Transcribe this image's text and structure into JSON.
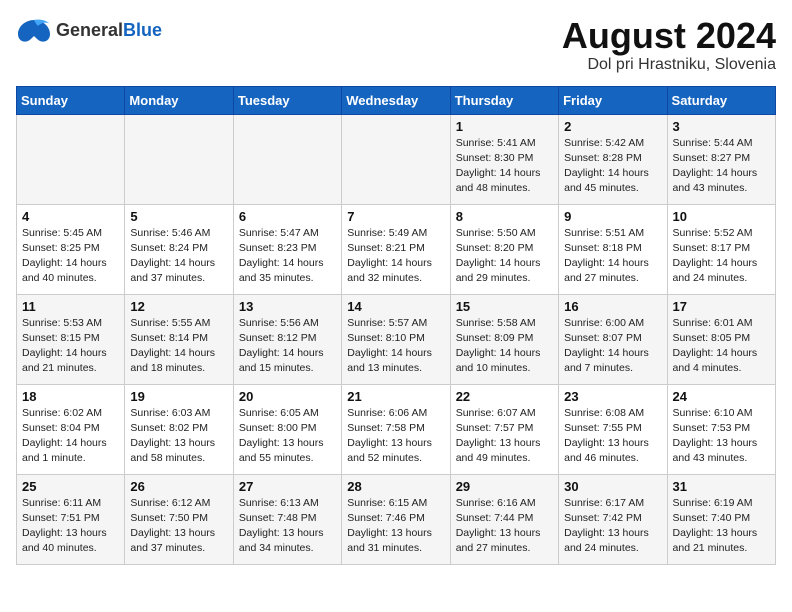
{
  "logo": {
    "general": "General",
    "blue": "Blue"
  },
  "title": "August 2024",
  "subtitle": "Dol pri Hrastniku, Slovenia",
  "weekdays": [
    "Sunday",
    "Monday",
    "Tuesday",
    "Wednesday",
    "Thursday",
    "Friday",
    "Saturday"
  ],
  "weeks": [
    [
      {
        "day": "",
        "content": ""
      },
      {
        "day": "",
        "content": ""
      },
      {
        "day": "",
        "content": ""
      },
      {
        "day": "",
        "content": ""
      },
      {
        "day": "1",
        "content": "Sunrise: 5:41 AM\nSunset: 8:30 PM\nDaylight: 14 hours\nand 48 minutes."
      },
      {
        "day": "2",
        "content": "Sunrise: 5:42 AM\nSunset: 8:28 PM\nDaylight: 14 hours\nand 45 minutes."
      },
      {
        "day": "3",
        "content": "Sunrise: 5:44 AM\nSunset: 8:27 PM\nDaylight: 14 hours\nand 43 minutes."
      }
    ],
    [
      {
        "day": "4",
        "content": "Sunrise: 5:45 AM\nSunset: 8:25 PM\nDaylight: 14 hours\nand 40 minutes."
      },
      {
        "day": "5",
        "content": "Sunrise: 5:46 AM\nSunset: 8:24 PM\nDaylight: 14 hours\nand 37 minutes."
      },
      {
        "day": "6",
        "content": "Sunrise: 5:47 AM\nSunset: 8:23 PM\nDaylight: 14 hours\nand 35 minutes."
      },
      {
        "day": "7",
        "content": "Sunrise: 5:49 AM\nSunset: 8:21 PM\nDaylight: 14 hours\nand 32 minutes."
      },
      {
        "day": "8",
        "content": "Sunrise: 5:50 AM\nSunset: 8:20 PM\nDaylight: 14 hours\nand 29 minutes."
      },
      {
        "day": "9",
        "content": "Sunrise: 5:51 AM\nSunset: 8:18 PM\nDaylight: 14 hours\nand 27 minutes."
      },
      {
        "day": "10",
        "content": "Sunrise: 5:52 AM\nSunset: 8:17 PM\nDaylight: 14 hours\nand 24 minutes."
      }
    ],
    [
      {
        "day": "11",
        "content": "Sunrise: 5:53 AM\nSunset: 8:15 PM\nDaylight: 14 hours\nand 21 minutes."
      },
      {
        "day": "12",
        "content": "Sunrise: 5:55 AM\nSunset: 8:14 PM\nDaylight: 14 hours\nand 18 minutes."
      },
      {
        "day": "13",
        "content": "Sunrise: 5:56 AM\nSunset: 8:12 PM\nDaylight: 14 hours\nand 15 minutes."
      },
      {
        "day": "14",
        "content": "Sunrise: 5:57 AM\nSunset: 8:10 PM\nDaylight: 14 hours\nand 13 minutes."
      },
      {
        "day": "15",
        "content": "Sunrise: 5:58 AM\nSunset: 8:09 PM\nDaylight: 14 hours\nand 10 minutes."
      },
      {
        "day": "16",
        "content": "Sunrise: 6:00 AM\nSunset: 8:07 PM\nDaylight: 14 hours\nand 7 minutes."
      },
      {
        "day": "17",
        "content": "Sunrise: 6:01 AM\nSunset: 8:05 PM\nDaylight: 14 hours\nand 4 minutes."
      }
    ],
    [
      {
        "day": "18",
        "content": "Sunrise: 6:02 AM\nSunset: 8:04 PM\nDaylight: 14 hours\nand 1 minute."
      },
      {
        "day": "19",
        "content": "Sunrise: 6:03 AM\nSunset: 8:02 PM\nDaylight: 13 hours\nand 58 minutes."
      },
      {
        "day": "20",
        "content": "Sunrise: 6:05 AM\nSunset: 8:00 PM\nDaylight: 13 hours\nand 55 minutes."
      },
      {
        "day": "21",
        "content": "Sunrise: 6:06 AM\nSunset: 7:58 PM\nDaylight: 13 hours\nand 52 minutes."
      },
      {
        "day": "22",
        "content": "Sunrise: 6:07 AM\nSunset: 7:57 PM\nDaylight: 13 hours\nand 49 minutes."
      },
      {
        "day": "23",
        "content": "Sunrise: 6:08 AM\nSunset: 7:55 PM\nDaylight: 13 hours\nand 46 minutes."
      },
      {
        "day": "24",
        "content": "Sunrise: 6:10 AM\nSunset: 7:53 PM\nDaylight: 13 hours\nand 43 minutes."
      }
    ],
    [
      {
        "day": "25",
        "content": "Sunrise: 6:11 AM\nSunset: 7:51 PM\nDaylight: 13 hours\nand 40 minutes."
      },
      {
        "day": "26",
        "content": "Sunrise: 6:12 AM\nSunset: 7:50 PM\nDaylight: 13 hours\nand 37 minutes."
      },
      {
        "day": "27",
        "content": "Sunrise: 6:13 AM\nSunset: 7:48 PM\nDaylight: 13 hours\nand 34 minutes."
      },
      {
        "day": "28",
        "content": "Sunrise: 6:15 AM\nSunset: 7:46 PM\nDaylight: 13 hours\nand 31 minutes."
      },
      {
        "day": "29",
        "content": "Sunrise: 6:16 AM\nSunset: 7:44 PM\nDaylight: 13 hours\nand 27 minutes."
      },
      {
        "day": "30",
        "content": "Sunrise: 6:17 AM\nSunset: 7:42 PM\nDaylight: 13 hours\nand 24 minutes."
      },
      {
        "day": "31",
        "content": "Sunrise: 6:19 AM\nSunset: 7:40 PM\nDaylight: 13 hours\nand 21 minutes."
      }
    ]
  ]
}
